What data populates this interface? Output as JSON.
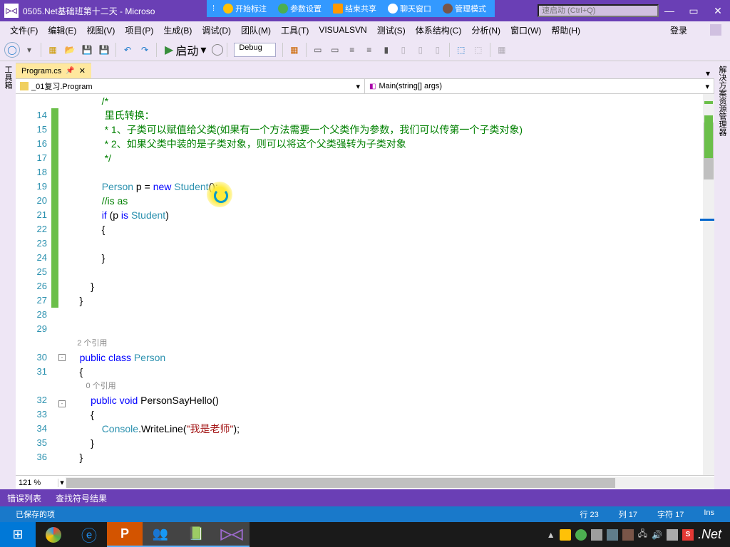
{
  "titlebar": {
    "title": "0505.Net基础班第十二天 - Microso"
  },
  "floatbar": {
    "items": [
      "开始标注",
      "参数设置",
      "结束共享",
      "聊天窗口",
      "管理模式"
    ]
  },
  "quicklaunch": {
    "placeholder": "速启动 (Ctrl+Q)"
  },
  "menu": {
    "items": [
      "文件(F)",
      "编辑(E)",
      "视图(V)",
      "项目(P)",
      "生成(B)",
      "调试(D)",
      "团队(M)",
      "工具(T)",
      "VISUALSVN",
      "测试(S)",
      "体系结构(C)",
      "分析(N)",
      "窗口(W)",
      "帮助(H)"
    ],
    "login": "登录"
  },
  "toolbar": {
    "start": "启动",
    "config": "Debug"
  },
  "vtab": {
    "left": "工具箱",
    "right": "解决方案资源管理器"
  },
  "doctab": {
    "name": "Program.cs"
  },
  "nav": {
    "left": "_01复习.Program",
    "right": "Main(string[] args)"
  },
  "code": {
    "lines": [
      {
        "n": "",
        "ind": "",
        "fold": "",
        "text": "            /*",
        "cls": "c-comment"
      },
      {
        "n": "14",
        "ind": "green",
        "fold": "",
        "text": "             里氏转换：",
        "cls": "c-comment"
      },
      {
        "n": "15",
        "ind": "green",
        "fold": "",
        "text": "             * 1、子类可以赋值给父类(如果有一个方法需要一个父类作为参数，我们可以传第一个子类对象)",
        "cls": "c-comment"
      },
      {
        "n": "16",
        "ind": "green",
        "fold": "",
        "text": "             * 2、如果父类中装的是子类对象，则可以将这个父类强转为子类对象",
        "cls": "c-comment"
      },
      {
        "n": "17",
        "ind": "green",
        "fold": "",
        "text": "             */",
        "cls": "c-comment"
      },
      {
        "n": "18",
        "ind": "green",
        "fold": "",
        "text": "",
        "cls": ""
      },
      {
        "n": "19",
        "ind": "green",
        "fold": "",
        "html": "            <span class='c-type'>Person</span> p = <span class='c-keyword'>new</span> <span class='c-type'>Student</span>();"
      },
      {
        "n": "20",
        "ind": "green",
        "fold": "",
        "html": "            <span class='c-comment'>//is as</span>"
      },
      {
        "n": "21",
        "ind": "green",
        "fold": "",
        "html": "            <span class='c-keyword'>if</span> (p <span class='c-keyword'>is</span> <span class='c-type'>Student</span>)"
      },
      {
        "n": "22",
        "ind": "green",
        "fold": "",
        "text": "            {",
        "cls": ""
      },
      {
        "n": "23",
        "ind": "green",
        "fold": "",
        "text": "",
        "cls": ""
      },
      {
        "n": "24",
        "ind": "green",
        "fold": "",
        "text": "            }",
        "cls": ""
      },
      {
        "n": "25",
        "ind": "green",
        "fold": "",
        "text": "",
        "cls": ""
      },
      {
        "n": "26",
        "ind": "green",
        "fold": "",
        "text": "        }",
        "cls": ""
      },
      {
        "n": "27",
        "ind": "green",
        "fold": "",
        "text": "    }",
        "cls": ""
      },
      {
        "n": "28",
        "ind": "",
        "fold": "",
        "text": "",
        "cls": ""
      },
      {
        "n": "29",
        "ind": "",
        "fold": "",
        "text": "",
        "cls": ""
      },
      {
        "n": "",
        "ind": "",
        "fold": "",
        "text": "    2 个引用",
        "cls": "c-ref"
      },
      {
        "n": "30",
        "ind": "",
        "fold": "-",
        "html": "    <span class='c-keyword'>public</span> <span class='c-keyword'>class</span> <span class='c-type'>Person</span>"
      },
      {
        "n": "31",
        "ind": "",
        "fold": "",
        "text": "    {",
        "cls": ""
      },
      {
        "n": "",
        "ind": "",
        "fold": "",
        "text": "        0 个引用",
        "cls": "c-ref"
      },
      {
        "n": "32",
        "ind": "",
        "fold": "-",
        "html": "        <span class='c-keyword'>public</span> <span class='c-keyword'>void</span> PersonSayHello()"
      },
      {
        "n": "33",
        "ind": "",
        "fold": "",
        "text": "        {",
        "cls": ""
      },
      {
        "n": "34",
        "ind": "",
        "fold": "",
        "html": "            <span class='c-type'>Console</span>.WriteLine(<span class='c-string'>\"我是老师\"</span>);"
      },
      {
        "n": "35",
        "ind": "",
        "fold": "",
        "text": "        }",
        "cls": ""
      },
      {
        "n": "36",
        "ind": "",
        "fold": "",
        "text": "    }",
        "cls": ""
      }
    ]
  },
  "zoom": "121 %",
  "bottomTabs": [
    "错误列表",
    "查找符号结果"
  ],
  "status": {
    "saved": "已保存的项",
    "line": "行 23",
    "col": "列 17",
    "char": "字符 17",
    "ins": "Ins"
  },
  "taskbar": {
    "net": ".Net"
  }
}
